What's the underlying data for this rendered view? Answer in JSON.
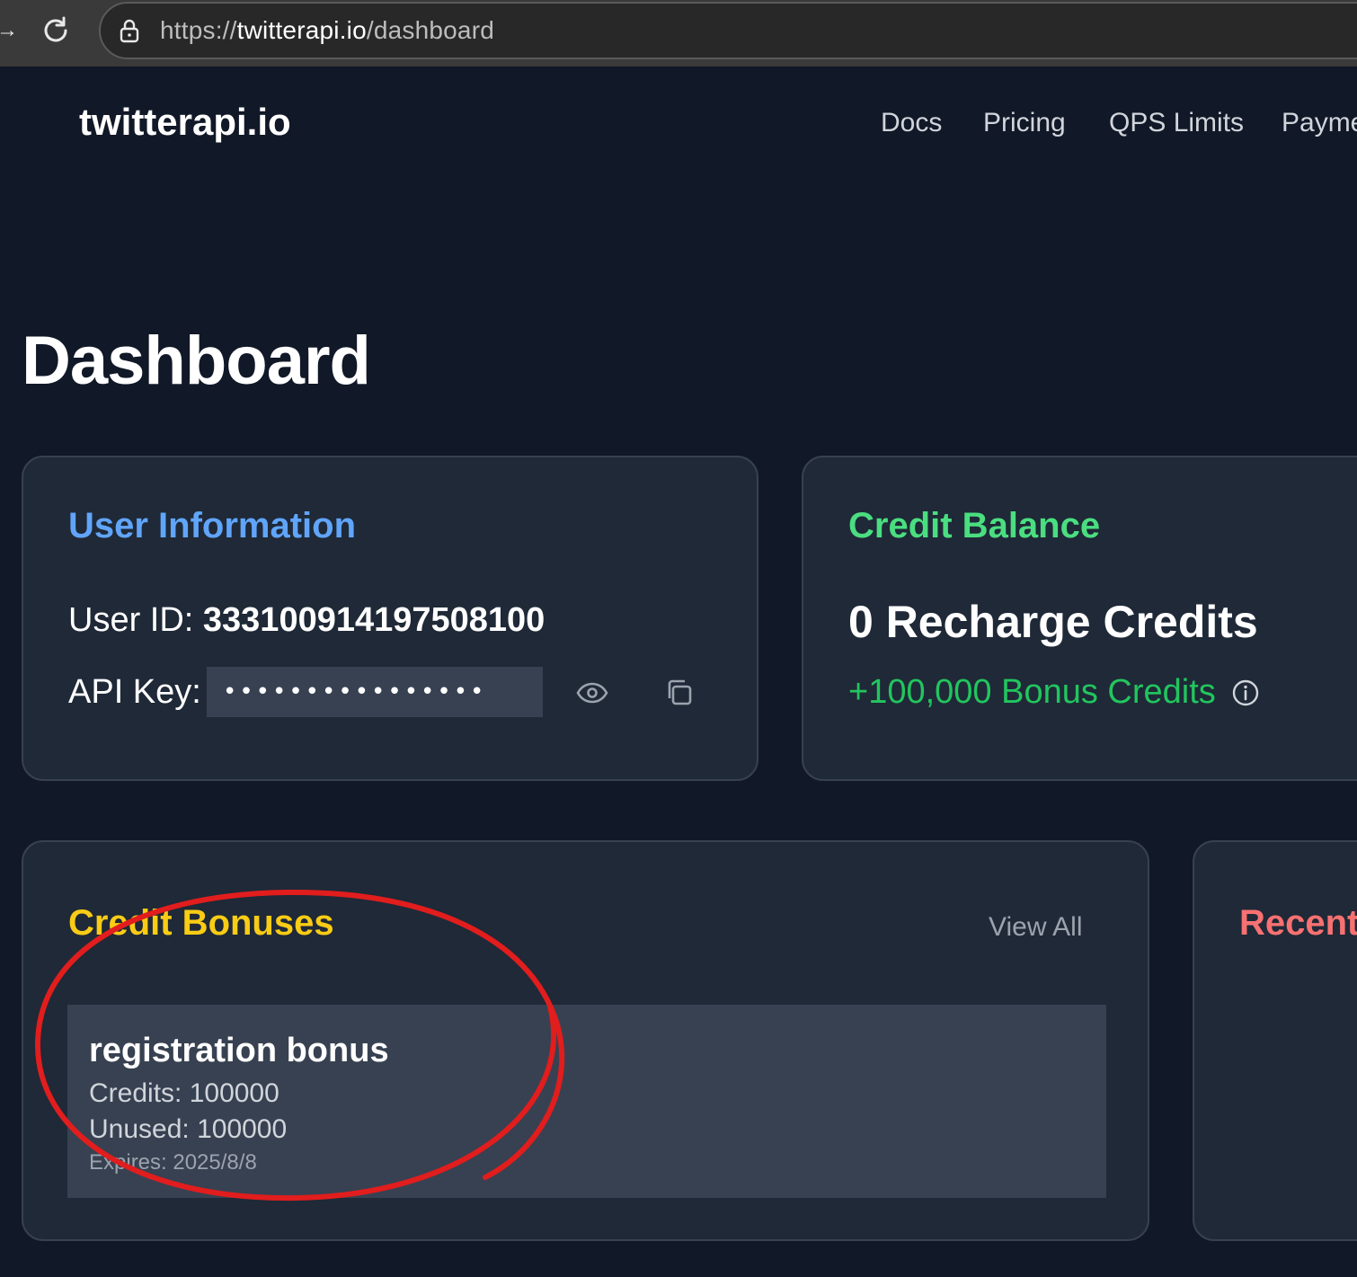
{
  "browser": {
    "url_scheme": "https://",
    "url_host": "twitterapi.io",
    "url_path": "/dashboard"
  },
  "nav": {
    "logo": "twitterapi.io",
    "links": [
      "Docs",
      "Pricing",
      "QPS Limits",
      "Payme"
    ]
  },
  "page_title": "Dashboard",
  "user_info": {
    "title": "User Information",
    "user_id_label": "User ID: ",
    "user_id_value": "333100914197508100",
    "api_key_label": "API Key:",
    "api_key_masked": "••••••••••••••••"
  },
  "credit_balance": {
    "title": "Credit Balance",
    "recharge": "0 Recharge Credits",
    "bonus": "+100,000 Bonus Credits"
  },
  "credit_bonuses": {
    "title": "Credit Bonuses",
    "view_all": "View All",
    "item": {
      "name": "registration bonus",
      "credits": "Credits: 100000",
      "unused": "Unused: 100000",
      "expires": "Expires: 2025/8/8"
    }
  },
  "recent": {
    "title": "Recent"
  },
  "colors": {
    "background": "#111827",
    "card": "#1f2937",
    "user_title": "#60a5fa",
    "credit_title": "#4ade80",
    "bonus_title": "#facc15",
    "recent_title": "#f87171",
    "annotation": "#e11d1d"
  },
  "icons": [
    "back-arrow-icon",
    "reload-icon",
    "lock-icon",
    "eye-icon",
    "copy-icon",
    "info-icon"
  ]
}
